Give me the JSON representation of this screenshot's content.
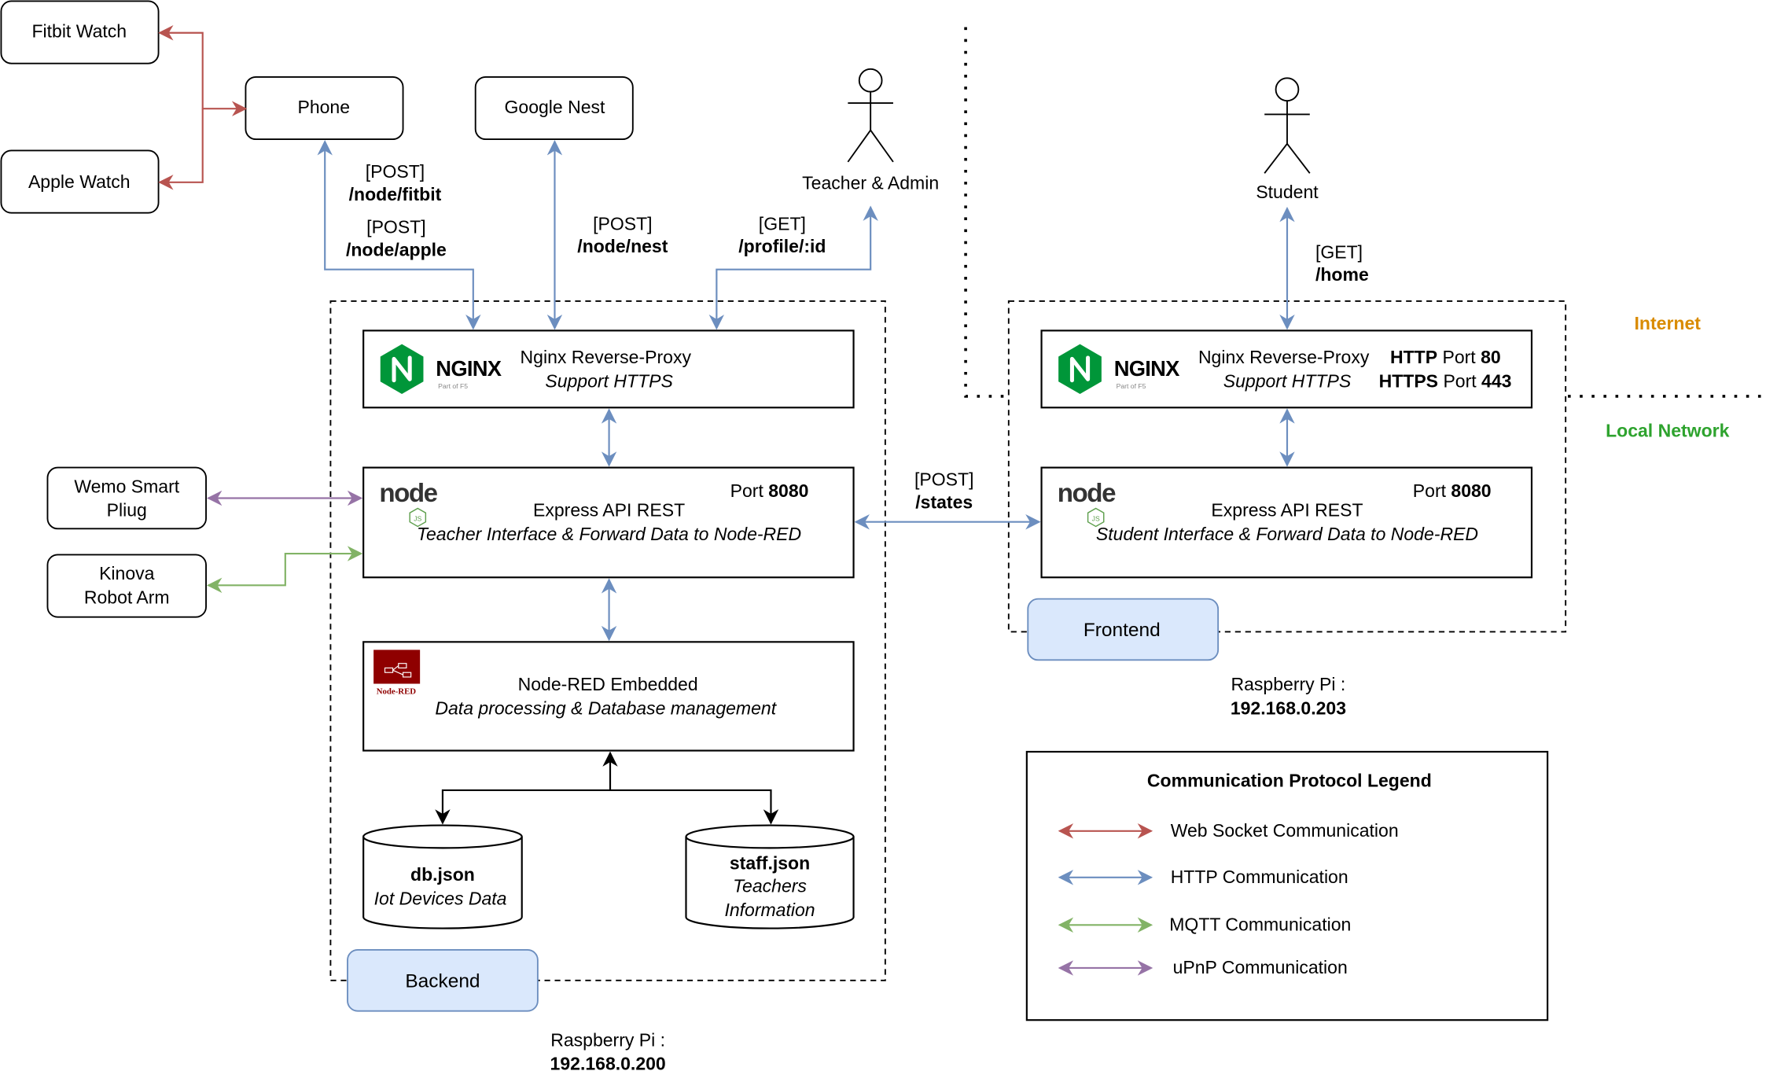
{
  "colors": {
    "websocket": "#b85450",
    "http": "#6c8ebf",
    "mqtt": "#82b366",
    "upnp": "#9673a6",
    "internet": "#d98b00",
    "local_network": "#2ea32e",
    "nginx_green": "#009639",
    "nodered_red": "#8f0000",
    "tag_fill": "#dae8fc"
  },
  "devices": {
    "fitbit": "Fitbit Watch",
    "apple": "Apple Watch",
    "phone": "Phone",
    "nest": "Google Nest",
    "wemo_line1": "Wemo Smart",
    "wemo_line2": "Pliug",
    "kinova_line1": "Kinova",
    "kinova_line2": "Robot Arm"
  },
  "actors": {
    "teacher": "Teacher & Admin",
    "student": "Student"
  },
  "routes": {
    "fitbit_method": "[POST]",
    "fitbit_path": "/node/fitbit",
    "apple_method": "[POST]",
    "apple_path": "/node/apple",
    "nest_method": "[POST]",
    "nest_path": "/node/nest",
    "profile_method": "[GET]",
    "profile_path": "/profile/:id",
    "home_method": "[GET]",
    "home_path": "/home",
    "states_method": "[POST]",
    "states_path": "/states"
  },
  "backend": {
    "nginx_logo": "NGINX",
    "nginx_logo_sub": "Part of F5",
    "nginx_title": "Nginx Reverse-Proxy",
    "nginx_sub": "Support HTTPS",
    "node_logo": "node",
    "node_logo_js": "JS",
    "express_port_label": "Port ",
    "express_port": "8080",
    "express_title": "Express API REST",
    "express_sub": "Teacher Interface & Forward Data to Node-RED",
    "nodered_logo": "Node-RED",
    "nodered_title": "Node-RED Embedded",
    "nodered_sub": "Data processing & Database management",
    "db_name": "db.json",
    "db_desc": "Iot Devices Data",
    "staff_name": "staff.json",
    "staff_desc1": "Teachers",
    "staff_desc2": "Information",
    "tag": "Backend",
    "host_label": "Raspberry Pi :",
    "host_ip": "192.168.0.200"
  },
  "frontend": {
    "nginx_logo": "NGINX",
    "nginx_logo_sub": "Part of F5",
    "nginx_title": "Nginx Reverse-Proxy",
    "nginx_sub": "Support HTTPS",
    "http_label": "HTTP",
    "http_port_label": " Port ",
    "http_port": "80",
    "https_label": "HTTPS",
    "https_port_label": " Port ",
    "https_port": "443",
    "node_logo": "node",
    "node_logo_js": "JS",
    "express_port_label": "Port ",
    "express_port": "8080",
    "express_title": "Express API REST",
    "express_sub": "Student Interface & Forward Data to Node-RED",
    "tag": "Frontend",
    "host_label": "Raspberry Pi :",
    "host_ip": "192.168.0.203"
  },
  "zones": {
    "internet": "Internet",
    "local": "Local Network"
  },
  "legend": {
    "title": "Communication Protocol Legend",
    "items": [
      {
        "label": "Web Socket Communication",
        "color": "#b85450"
      },
      {
        "label": "HTTP Communication",
        "color": "#6c8ebf"
      },
      {
        "label": "MQTT Communication",
        "color": "#82b366"
      },
      {
        "label": "uPnP Communication",
        "color": "#9673a6"
      }
    ]
  }
}
